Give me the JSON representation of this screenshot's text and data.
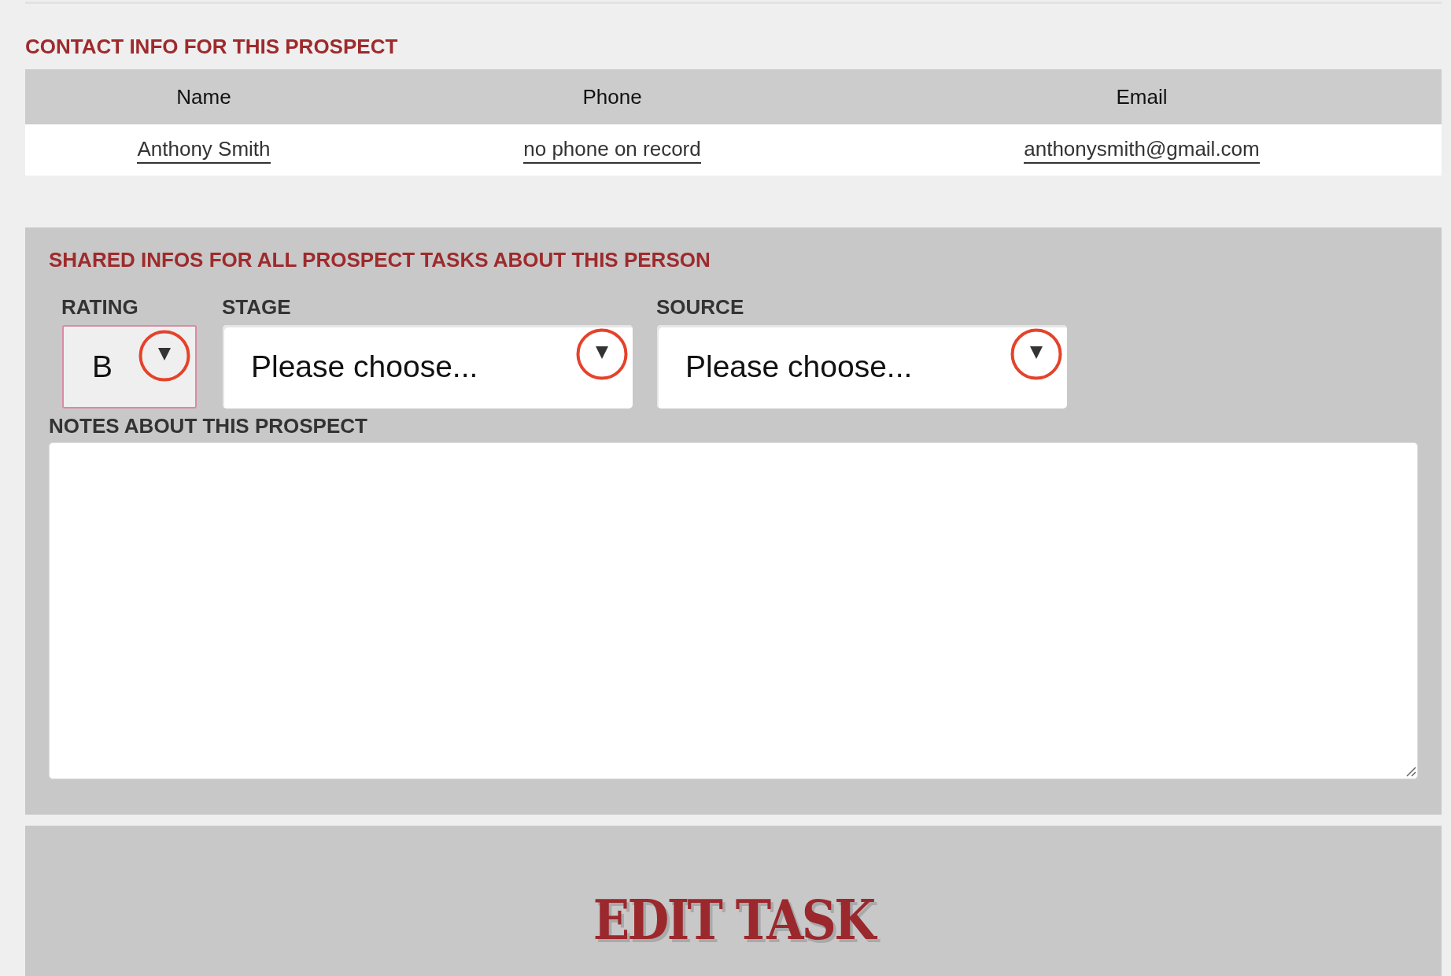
{
  "contact_section": {
    "heading": "CONTACT INFO FOR THIS PROSPECT",
    "table": {
      "columns": [
        "Name",
        "Phone",
        "Email"
      ],
      "rows": [
        [
          "Anthony Smith",
          "no phone on record",
          "anthonysmith@gmail.com"
        ]
      ]
    }
  },
  "shared_section": {
    "heading": "SHARED INFOS FOR ALL PROSPECT TASKS ABOUT THIS PERSON",
    "fields": [
      {
        "label": "RATING",
        "value": "B",
        "focused": true,
        "highlighted": true
      },
      {
        "label": "STAGE",
        "value": "Please choose...",
        "focused": false,
        "highlighted": true
      },
      {
        "label": "SOURCE",
        "value": "Please choose...",
        "focused": false,
        "highlighted": true
      }
    ],
    "notes": {
      "label": "NOTES ABOUT THIS PROSPECT"
    }
  },
  "footer": {
    "button": "EDIT TASK"
  }
}
